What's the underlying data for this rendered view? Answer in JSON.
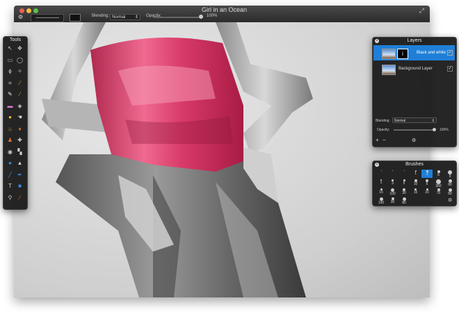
{
  "window": {
    "title": "Girl in an Ocean"
  },
  "toolbar": {
    "blending_label": "Blending:",
    "blending_value": "Normal",
    "opacity_label": "Opacity:",
    "opacity_value": "100%"
  },
  "tools_panel": {
    "title": "Tools",
    "tools": [
      {
        "icon": "arrow-move-icon",
        "glyph": "↖",
        "color": "#cfcfcf"
      },
      {
        "icon": "move-icon",
        "glyph": "✥",
        "color": "#cfcfcf"
      },
      {
        "icon": "rect-select-icon",
        "glyph": "▭",
        "color": "#cfcfcf"
      },
      {
        "icon": "ellipse-select-icon",
        "glyph": "◯",
        "color": "#cfcfcf"
      },
      {
        "icon": "lasso-icon",
        "glyph": "ϕ",
        "color": "#cfcfcf"
      },
      {
        "icon": "magic-wand-icon",
        "glyph": "✧",
        "color": "#cfcfcf"
      },
      {
        "icon": "crop-icon",
        "glyph": "⌗",
        "color": "#cfcfcf"
      },
      {
        "icon": "eyedropper-icon",
        "glyph": "⁄",
        "color": "#e0a030"
      },
      {
        "icon": "pencil-icon",
        "glyph": "✎",
        "color": "#e6e6e6"
      },
      {
        "icon": "brush-icon",
        "glyph": "⁄",
        "color": "#7ec44a"
      },
      {
        "icon": "eraser-icon",
        "glyph": "▬",
        "color": "#e27ad0"
      },
      {
        "icon": "paint-bucket-icon",
        "glyph": "◈",
        "color": "#cfcfcf"
      },
      {
        "icon": "blur-icon",
        "glyph": "●",
        "color": "#f0c040"
      },
      {
        "icon": "smudge-icon",
        "glyph": "☚",
        "color": "#cfcfcf"
      },
      {
        "icon": "burn-icon",
        "glyph": "♨",
        "color": "#e0a030"
      },
      {
        "icon": "dodge-icon",
        "glyph": "♦",
        "color": "#e07030"
      },
      {
        "icon": "clone-stamp-icon",
        "glyph": "♟",
        "color": "#e07030"
      },
      {
        "icon": "heal-icon",
        "glyph": "✚",
        "color": "#cfcfcf"
      },
      {
        "icon": "red-eye-icon",
        "glyph": "◉",
        "color": "#cfcfcf"
      },
      {
        "icon": "sponge-icon",
        "glyph": "▚",
        "color": "#cfcfcf"
      },
      {
        "icon": "drop-icon",
        "glyph": "●",
        "color": "#3a8fe0"
      },
      {
        "icon": "sharpen-icon",
        "glyph": "▲",
        "color": "#cfcfcf"
      },
      {
        "icon": "line-icon",
        "glyph": "╱",
        "color": "#3a8fe0"
      },
      {
        "icon": "pen-icon",
        "glyph": "✒",
        "color": "#3a8fe0"
      },
      {
        "icon": "text-icon",
        "glyph": "T",
        "color": "#cfcfcf"
      },
      {
        "icon": "shape-icon",
        "glyph": "■",
        "color": "#3a8fe0"
      },
      {
        "icon": "zoom-icon",
        "glyph": "⚲",
        "color": "#cfcfcf"
      },
      {
        "icon": "hand-icon",
        "glyph": "⁄",
        "color": "#e07030"
      }
    ]
  },
  "layers_panel": {
    "title": "Layers",
    "layers": [
      {
        "name": "Black and white",
        "selected": true
      },
      {
        "name": "Background Layer",
        "selected": false
      }
    ],
    "blending_label": "Blending:",
    "blending_value": "Normal",
    "opacity_label": "Opacity:",
    "opacity_value": "100%",
    "add_glyph": "+",
    "remove_glyph": "−",
    "gear_glyph": "⚙"
  },
  "brushes_panel": {
    "title": "Brushes",
    "brushes": [
      {
        "size": ""
      },
      {
        "size": ""
      },
      {
        "size": ""
      },
      {
        "size": "1"
      },
      {
        "size": "3"
      },
      {
        "size": "6"
      },
      {
        "size": "9"
      },
      {
        "size": "1"
      },
      {
        "size": "3"
      },
      {
        "size": "5"
      },
      {
        "size": "10"
      },
      {
        "size": "6"
      },
      {
        "size": "350"
      },
      {
        "size": "80"
      },
      {
        "size": "15"
      },
      {
        "size": "100"
      },
      {
        "size": "30"
      },
      {
        "size": "15"
      },
      {
        "size": "20"
      },
      {
        "size": "70"
      },
      {
        "size": "80"
      },
      {
        "size": "100"
      },
      {
        "size": "30"
      },
      {
        "size": "80"
      }
    ],
    "selected_index": 4,
    "gear_glyph": "⚙"
  },
  "icons": {
    "close": "×",
    "fullscreen": "⤢",
    "gear": "⚙"
  }
}
